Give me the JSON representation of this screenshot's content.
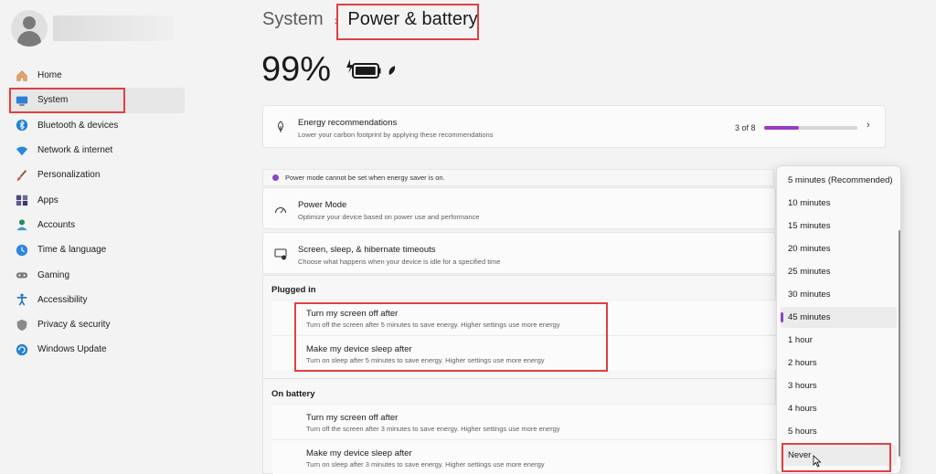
{
  "sidebar": {
    "items": [
      {
        "label": "Home",
        "icon": "home-icon"
      },
      {
        "label": "System",
        "icon": "system-icon",
        "selected": true
      },
      {
        "label": "Bluetooth & devices",
        "icon": "bluetooth-icon"
      },
      {
        "label": "Network & internet",
        "icon": "wifi-icon"
      },
      {
        "label": "Personalization",
        "icon": "brush-icon"
      },
      {
        "label": "Apps",
        "icon": "apps-icon"
      },
      {
        "label": "Accounts",
        "icon": "accounts-icon"
      },
      {
        "label": "Time & language",
        "icon": "globe-clock-icon"
      },
      {
        "label": "Gaming",
        "icon": "gamepad-icon"
      },
      {
        "label": "Accessibility",
        "icon": "accessibility-icon"
      },
      {
        "label": "Privacy & security",
        "icon": "shield-icon"
      },
      {
        "label": "Windows Update",
        "icon": "update-icon"
      }
    ]
  },
  "header": {
    "parent": "System",
    "separator": "›",
    "current": "Power & battery"
  },
  "battery": {
    "percent_label": "99%",
    "level": 0.99
  },
  "energy": {
    "title": "Energy recommendations",
    "subtitle": "Lower your carbon footprint by applying these recommendations",
    "progress_label": "3 of 8",
    "progress": 0.375,
    "accent": "#9a3ac2"
  },
  "notice": {
    "text": "Power mode cannot be set when energy saver is on."
  },
  "power_mode": {
    "title": "Power Mode",
    "subtitle": "Optimize your device based on power use and performance"
  },
  "timeouts": {
    "title": "Screen, sleep, & hibernate timeouts",
    "subtitle": "Choose what happens when your device is idle for a specified time"
  },
  "plugged_in": {
    "label": "Plugged in",
    "screen_title": "Turn my screen off after",
    "screen_sub": "Turn off the screen after 5 minutes to save energy. Higher settings use more energy",
    "sleep_title": "Make my device sleep after",
    "sleep_sub": "Turn on sleep after 5 minutes to save energy. Higher settings use more energy"
  },
  "on_battery": {
    "label": "On battery",
    "screen_title": "Turn my screen off after",
    "screen_sub": "Turn off the screen after 3 minutes to save energy. Higher settings use more energy",
    "sleep_title": "Make my device sleep after",
    "sleep_sub": "Turn on sleep after 3 minutes to save energy. Higher settings use more energy"
  },
  "dropdown": {
    "options": [
      "5 minutes (Recommended)",
      "10 minutes",
      "15 minutes",
      "20 minutes",
      "25 minutes",
      "30 minutes",
      "45 minutes",
      "1 hour",
      "2 hours",
      "3 hours",
      "4 hours",
      "5 hours",
      "Never"
    ],
    "selected": "45 minutes",
    "hovered": "Never"
  },
  "colors": {
    "highlight_box": "#e04040",
    "accent": "#8a45c8"
  }
}
